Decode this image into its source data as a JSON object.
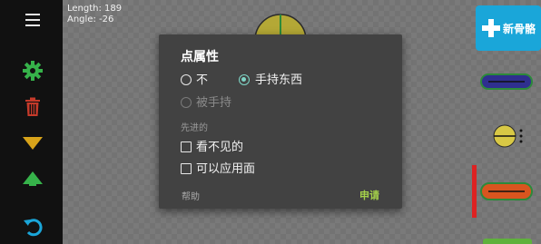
{
  "canvas": {
    "length_text": "Length: 189",
    "angle_text": "Angle: -26",
    "new_bone_label": "新骨骼"
  },
  "sidebar": {
    "icons": [
      "menu-icon",
      "gear-icon",
      "trash-icon",
      "arrow-down-icon",
      "arrow-up-icon",
      "undo-icon"
    ]
  },
  "dialog": {
    "title": "点属性",
    "options": {
      "none": "不",
      "holding": "手持东西",
      "held": "被手持"
    },
    "section_title": "先进的",
    "checkboxes": {
      "invisible": "看不见的",
      "apply_face": "可以应用面"
    },
    "help": "帮助",
    "apply": "申请"
  },
  "colors": {
    "accent_green": "#36b24a",
    "trash_red": "#c63a2a",
    "arrow_yellow": "#d8a31a",
    "dialog_bg": "#424242",
    "teal": "#7fd6c7",
    "apply_green": "#a4d04a",
    "new_bone_blue": "#1aa6d9"
  }
}
